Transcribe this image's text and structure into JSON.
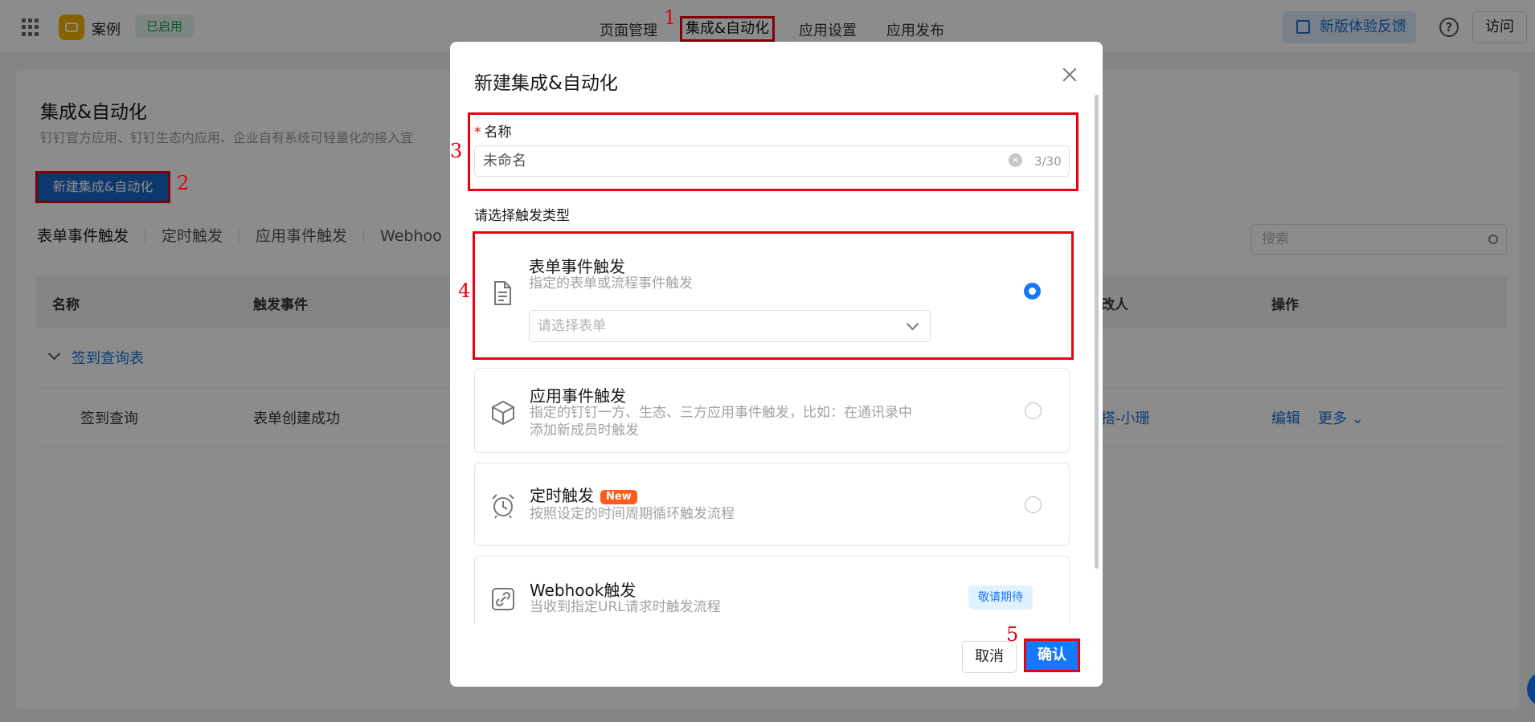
{
  "topbar": {
    "app_name": "案例",
    "status": "已启用",
    "nav": [
      "页面管理",
      "集成&自动化",
      "应用设置",
      "应用发布"
    ],
    "feedback": "新版体验反馈",
    "help": "?",
    "visit": "访问"
  },
  "page": {
    "title": "集成&自动化",
    "desc": "钉钉官方应用、钉钉生态内应用、企业自有系统可轻量化的接入宜",
    "new_button": "新建集成&自动化",
    "tabs": [
      "表单事件触发",
      "定时触发",
      "应用事件触发",
      "Webhoo"
    ],
    "search_placeholder": "搜索",
    "table_headers": {
      "name": "名称",
      "event": "触发事件",
      "modifier": "改人",
      "ops": "操作"
    },
    "group_name": "签到查询表",
    "row": {
      "name": "签到查询",
      "event": "表单创建成功",
      "modifier": "搭-小珊",
      "edit": "编辑",
      "more": "更多"
    }
  },
  "modal": {
    "title": "新建集成&自动化",
    "name_label": "名称",
    "name_value": "未命名",
    "counter": "3/30",
    "trigger_label": "请选择触发类型",
    "cards": [
      {
        "title": "表单事件触发",
        "desc": "指定的表单或流程事件触发",
        "select_placeholder": "请选择表单",
        "icon": "document-icon",
        "checked": true
      },
      {
        "title": "应用事件触发",
        "desc_line1": "指定的钉钉一方、生态、三方应用事件触发，比如：在通讯录中",
        "desc_line2": "添加新成员时触发",
        "icon": "cube-icon",
        "checked": false
      },
      {
        "title": "定时触发",
        "badge": "New",
        "desc": "按照设定的时间周期循环触发流程",
        "icon": "alarm-clock-icon",
        "checked": false
      },
      {
        "title": "Webhook触发",
        "desc": "当收到指定URL请求时触发流程",
        "badge": "敬请期待",
        "icon": "link-icon"
      }
    ],
    "cancel": "取消",
    "confirm": "确认"
  },
  "annotations": [
    "1",
    "2",
    "3",
    "4",
    "5"
  ],
  "colors": {
    "primary": "#1677ff",
    "highlight": "#e60012",
    "new_badge": "#ff5a1f"
  }
}
